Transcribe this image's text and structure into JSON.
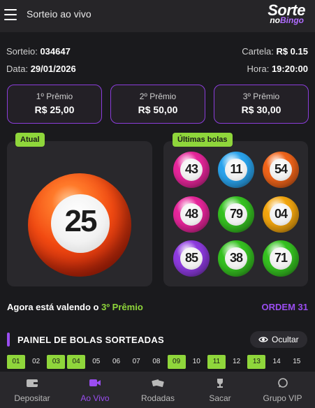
{
  "header": {
    "title": "Sorteio ao vivo",
    "logo_top": "Sorte",
    "logo_no": "no",
    "logo_bingo": "Bingo"
  },
  "info": {
    "sorteio_label": "Sorteio:",
    "sorteio_value": "034647",
    "cartela_label": "Cartela:",
    "cartela_value": "R$ 0.15",
    "data_label": "Data:",
    "data_value": "29/01/2026",
    "hora_label": "Hora:",
    "hora_value": "19:20:00"
  },
  "prizes": [
    {
      "label": "1º Prêmio",
      "value": "R$ 25,00"
    },
    {
      "label": "2º Prêmio",
      "value": "R$ 50,00"
    },
    {
      "label": "3º Prêmio",
      "value": "R$ 30,00"
    }
  ],
  "current": {
    "tag": "Atual",
    "number": "25"
  },
  "last_balls": {
    "tag": "Últimas bolas",
    "balls": [
      {
        "number": "43",
        "color": "#e7269b"
      },
      {
        "number": "11",
        "color": "#2aa4ee"
      },
      {
        "number": "54",
        "color": "#f0641a"
      },
      {
        "number": "48",
        "color": "#e7269b"
      },
      {
        "number": "79",
        "color": "#36c221"
      },
      {
        "number": "04",
        "color": "#f3a60f"
      },
      {
        "number": "85",
        "color": "#8e3be0"
      },
      {
        "number": "38",
        "color": "#36c221"
      },
      {
        "number": "71",
        "color": "#36c221"
      }
    ]
  },
  "status": {
    "prefix": "Agora está valendo o ",
    "highlight": "3º Prêmio",
    "ordem": "ORDEM 31"
  },
  "panel": {
    "title": "PAINEL DE BOLAS SORTEADAS",
    "hide_label": "Ocultar"
  },
  "board": [
    {
      "n": "01",
      "on": true
    },
    {
      "n": "02",
      "on": false
    },
    {
      "n": "03",
      "on": true
    },
    {
      "n": "04",
      "on": true
    },
    {
      "n": "05",
      "on": false
    },
    {
      "n": "06",
      "on": false
    },
    {
      "n": "07",
      "on": false
    },
    {
      "n": "08",
      "on": false
    },
    {
      "n": "09",
      "on": true
    },
    {
      "n": "10",
      "on": false
    },
    {
      "n": "11",
      "on": true
    },
    {
      "n": "12",
      "on": false
    },
    {
      "n": "13",
      "on": true
    },
    {
      "n": "14",
      "on": false
    },
    {
      "n": "15",
      "on": false
    }
  ],
  "nav": [
    {
      "label": "Depositar",
      "icon": "wallet-icon",
      "active": false
    },
    {
      "label": "Ao Vivo",
      "icon": "video-icon",
      "active": true
    },
    {
      "label": "Rodadas",
      "icon": "tickets-icon",
      "active": false
    },
    {
      "label": "Sacar",
      "icon": "trophy-icon",
      "active": false
    },
    {
      "label": "Grupo VIP",
      "icon": "whatsapp-icon",
      "active": false
    }
  ],
  "colors": {
    "accent": "#9a4df0",
    "green": "#8fd63b",
    "bg": "#1a1a1d"
  }
}
